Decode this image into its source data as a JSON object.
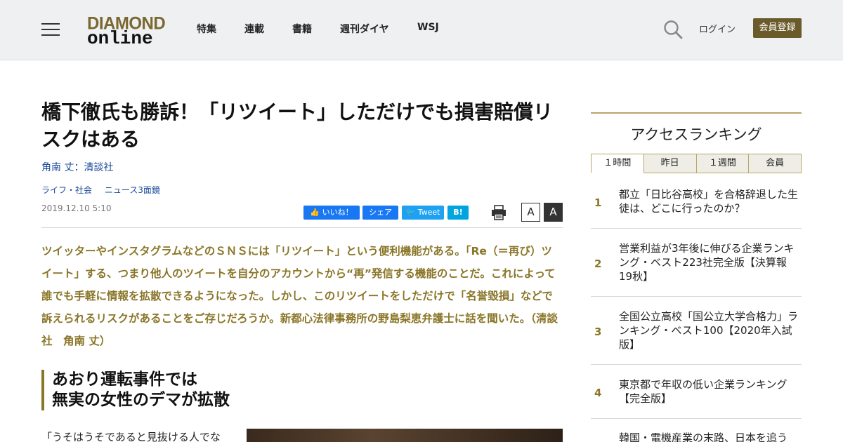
{
  "header": {
    "logo_top": "DIAMOND",
    "logo_bottom": "online",
    "nav": [
      "特集",
      "連載",
      "書籍",
      "週刊ダイヤ",
      "WSJ"
    ],
    "login": "ログイン",
    "register": "会員登録"
  },
  "article": {
    "title": "橋下徹氏も勝訴！「リツイート」しただけでも損害賠償リスクはある",
    "author": "角南 丈：清談社",
    "categories": [
      "ライフ・社会",
      "ニュース3面鏡"
    ],
    "date": "2019.12.10 5:10",
    "share": {
      "like": "いいね！",
      "share": "シェア",
      "tweet": "Tweet",
      "hatena": "B!"
    },
    "font_small": "A",
    "font_large": "A",
    "lead": "ツイッターやインスタグラムなどのＳＮＳには「リツイート」という便利機能がある。「Re（＝再び）ツイート」する、つまり他人のツイートを自分のアカウントから“再”発信する機能のことだ。これによって誰でも手軽に情報を拡散できるようになった。しかし、このリツイートをしただけで「名誉毀損」などで訴えられるリスクがあることをご存じだろうか。新都心法律事務所の野島梨恵弁護士に話を聞いた。（清談社　角南 丈）",
    "section_title_1": "あおり運転事件では",
    "section_title_2": "無実の女性のデマが拡散",
    "body_start": "「うそはうそであると見抜ける人でな"
  },
  "sidebar": {
    "title": "アクセスランキング",
    "tabs": [
      "１時間",
      "昨日",
      "１週間",
      "会員"
    ],
    "ranking": [
      {
        "num": "1",
        "text": "都立「日比谷高校」を合格辞退した生徒は、どこに行ったのか？"
      },
      {
        "num": "2",
        "text": "営業利益が3年後に伸びる企業ランキング・ベスト223社完全版【決算報19秋】"
      },
      {
        "num": "3",
        "text": "全国公立高校「国公立大学合格力」ランキング・ベスト100【2020年入試版】"
      },
      {
        "num": "4",
        "text": "東京都で年収の低い企業ランキング【完全版】"
      },
      {
        "num": "5",
        "text": "韓国・電機産業の末路、日本を追う"
      }
    ]
  },
  "colors": {
    "accent": "#8a7628",
    "register_bg": "#6b5a2a",
    "link": "#1b4a9a",
    "facebook": "#1877f2",
    "twitter": "#1da1f2",
    "hatena": "#00a4de"
  }
}
